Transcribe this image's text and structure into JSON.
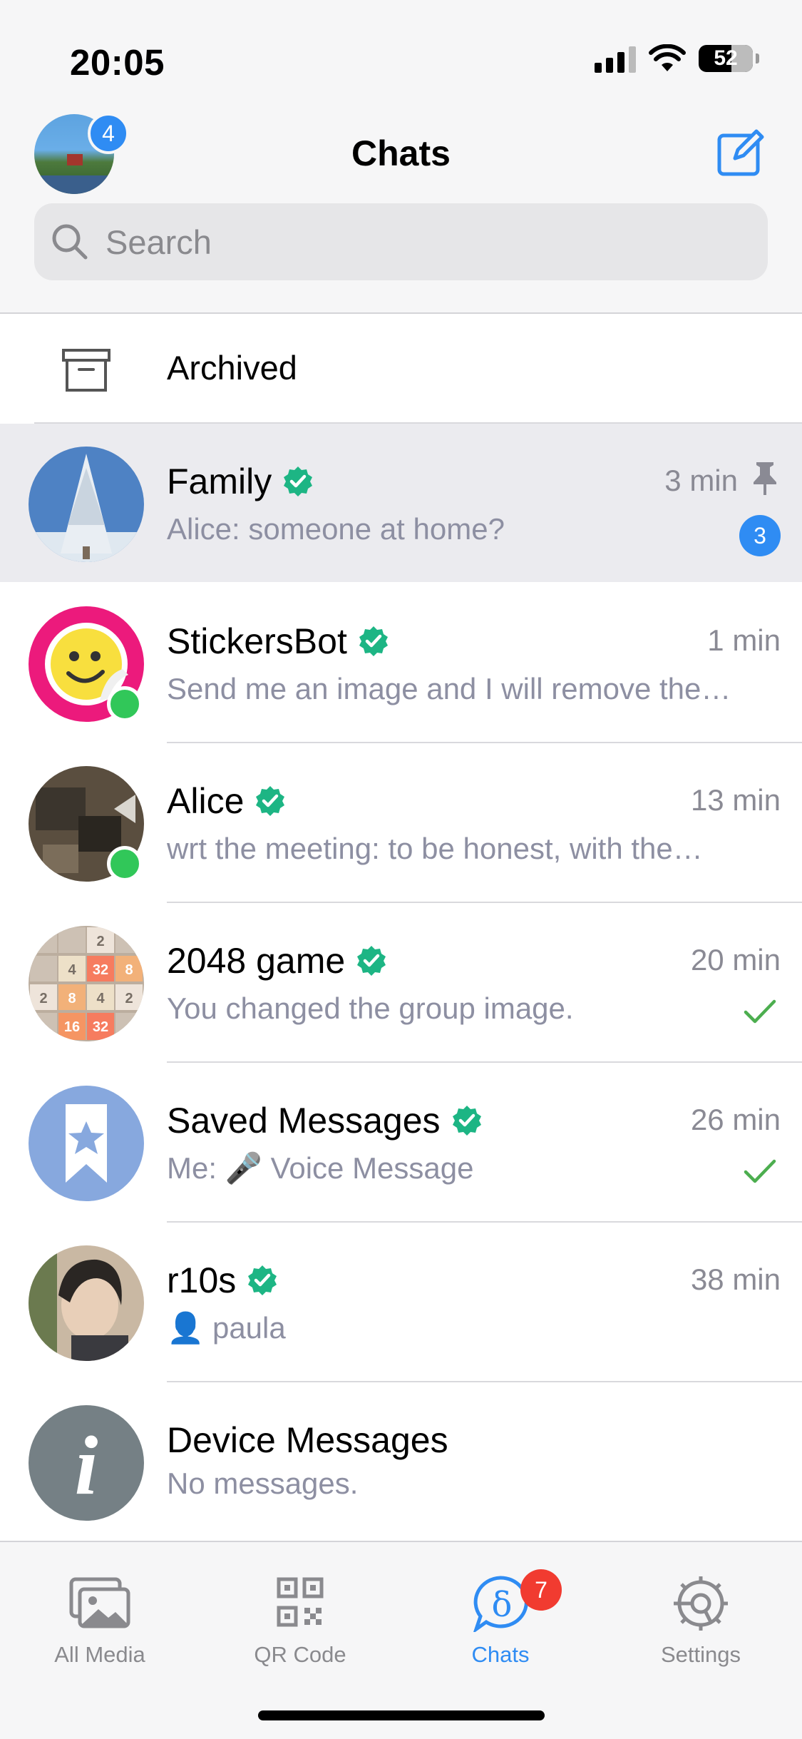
{
  "status_bar": {
    "time": "20:05",
    "battery": "52"
  },
  "header": {
    "title": "Chats",
    "profile_badge_count": "4",
    "search_placeholder": "Search"
  },
  "archived": {
    "label": "Archived"
  },
  "chats": [
    {
      "name": "Family",
      "time": "3 min",
      "preview": "Alice: someone at home?",
      "unread": "3",
      "pinned": true,
      "verified": true
    },
    {
      "name": "StickersBot",
      "time": "1 min",
      "preview": "Send me an image and I will remove the…",
      "online": true,
      "verified": true
    },
    {
      "name": "Alice",
      "time": "13 min",
      "preview": "wrt the meeting: to be honest, with the…",
      "online": true,
      "verified": true
    },
    {
      "name": "2048 game",
      "time": "20 min",
      "preview": "You changed the group image.",
      "delivered": true,
      "verified": true,
      "tiles": [
        "2",
        "4",
        "32",
        "8",
        "2",
        "8",
        "4",
        "2",
        "16",
        "32"
      ]
    },
    {
      "name": "Saved Messages",
      "time": "26 min",
      "preview_prefix": "Me:",
      "preview_emoji": "🎤",
      "preview": "Voice Message",
      "delivered": true,
      "verified": true
    },
    {
      "name": "r10s",
      "time": "38 min",
      "preview_emoji": "👤",
      "preview": "paula",
      "verified": true
    },
    {
      "name": "Device Messages",
      "preview": "No messages.",
      "avatar_letter": "i"
    }
  ],
  "tabs": [
    {
      "label": "All Media",
      "icon": "gallery-icon"
    },
    {
      "label": "QR Code",
      "icon": "qr-code-icon"
    },
    {
      "label": "Chats",
      "icon": "delta-chat-icon",
      "badge": "7",
      "active": true
    },
    {
      "label": "Settings",
      "icon": "gear-icon"
    }
  ],
  "colors": {
    "accent": "#2f8cf3",
    "verified": "#1db584",
    "online": "#31c759",
    "badge_red": "#f13b30",
    "preview_text": "#8d8fa2",
    "pinned_row_bg": "#ebebef"
  }
}
